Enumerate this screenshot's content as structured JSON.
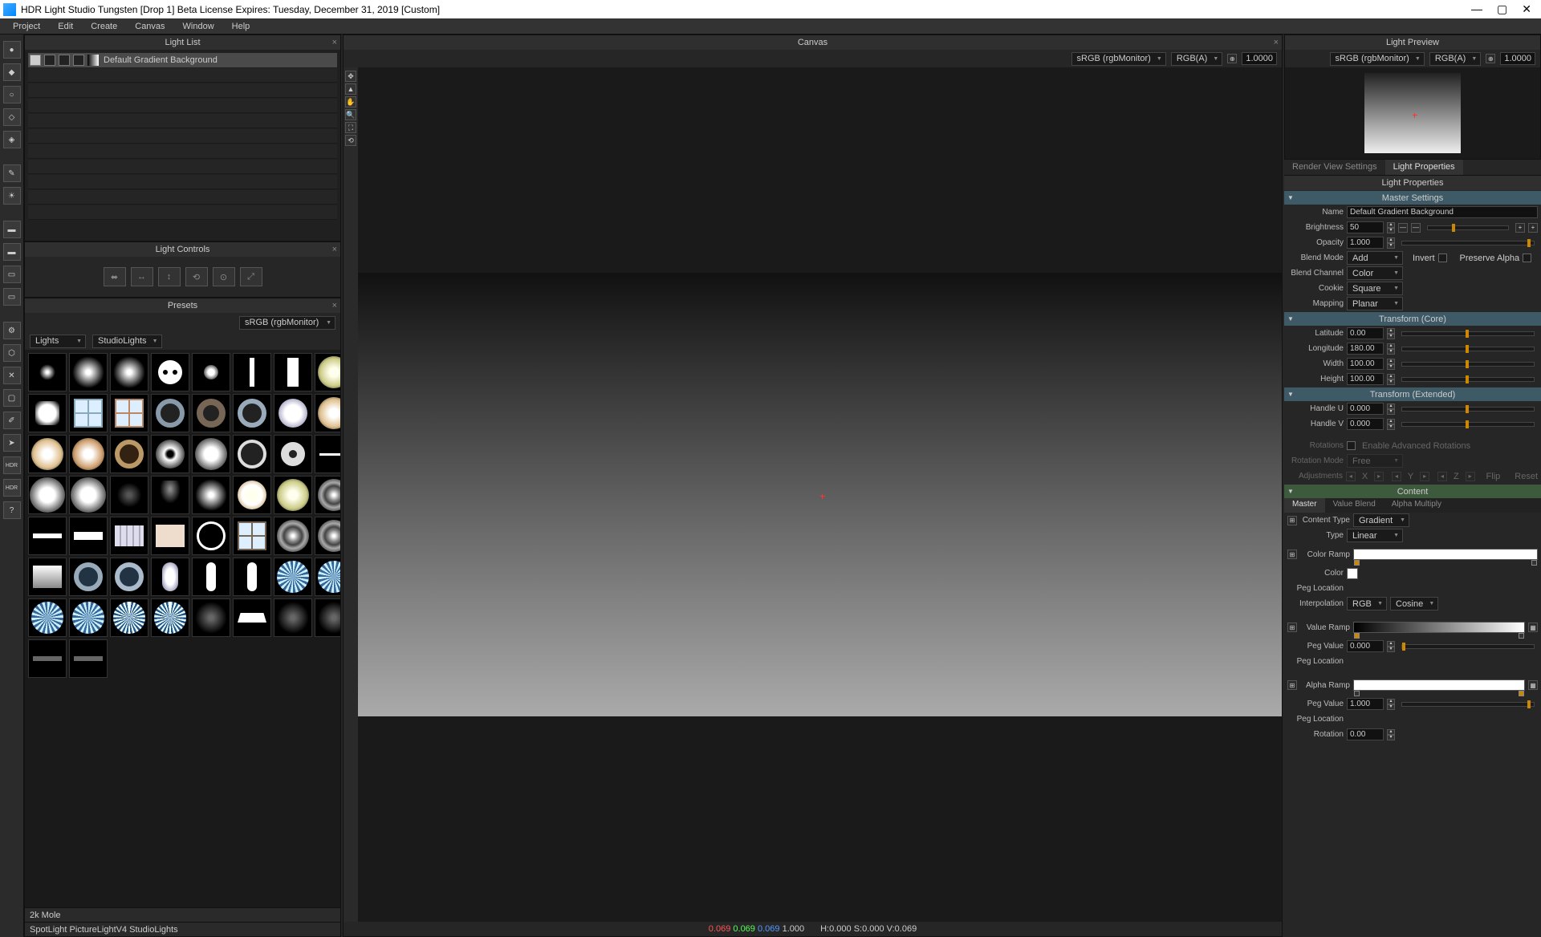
{
  "window": {
    "title": "HDR Light Studio Tungsten [Drop 1] Beta License Expires: Tuesday, December 31, 2019  [Custom]"
  },
  "menu": [
    "Project",
    "Edit",
    "Create",
    "Canvas",
    "Window",
    "Help"
  ],
  "panels": {
    "lightlist": "Light List",
    "lightctrl": "Light Controls",
    "presets": "Presets",
    "canvas": "Canvas",
    "preview": "Light Preview",
    "props": "Light Properties"
  },
  "lightlist": {
    "item": "Default Gradient Background"
  },
  "preset": {
    "colorspace": "sRGB (rgbMonitor)",
    "cat1": "Lights",
    "cat2": "StudioLights",
    "status1": "2k Mole",
    "status2": "SpotLight PictureLightV4 StudioLights"
  },
  "canvas": {
    "cs": "sRGB (rgbMonitor)",
    "mode": "RGB(A)",
    "exposure": "1.0000",
    "status_r": "0.069",
    "status_g": "0.069",
    "status_b": "0.069",
    "status_a": "1.000",
    "status_hsv": "H:0.000 S:0.000 V:0.069"
  },
  "preview": {
    "cs": "sRGB (rgbMonitor)",
    "mode": "RGB(A)",
    "exposure": "1.0000"
  },
  "tabs": {
    "rv": "Render View Settings",
    "lp": "Light Properties"
  },
  "sec": {
    "master": "Master Settings",
    "tcore": "Transform (Core)",
    "text": "Transform (Extended)",
    "content": "Content"
  },
  "prop": {
    "name_lbl": "Name",
    "name_val": "Default Gradient Background",
    "bright_lbl": "Brightness",
    "bright_val": "50",
    "opac_lbl": "Opacity",
    "opac_val": "1.000",
    "blend_lbl": "Blend Mode",
    "blend_val": "Add",
    "invert_lbl": "Invert",
    "preservea_lbl": "Preserve Alpha",
    "bchan_lbl": "Blend Channel",
    "bchan_val": "Color",
    "cookie_lbl": "Cookie",
    "cookie_val": "Square",
    "map_lbl": "Mapping",
    "map_val": "Planar",
    "lat_lbl": "Latitude",
    "lat_val": "0.00",
    "lon_lbl": "Longitude",
    "lon_val": "180.00",
    "w_lbl": "Width",
    "w_val": "100.00",
    "h_lbl": "Height",
    "h_val": "100.00",
    "hu_lbl": "Handle U",
    "hu_val": "0.000",
    "hv_lbl": "Handle V",
    "hv_val": "0.000",
    "rot_lbl": "Rotations",
    "rot_chk": "Enable Advanced Rotations",
    "rotm_lbl": "Rotation Mode",
    "rotm_val": "Free",
    "adj_lbl": "Adjustments",
    "adj_x": "X",
    "adj_y": "Y",
    "adj_z": "Z",
    "adj_flip": "Flip",
    "adj_reset": "Reset",
    "subtabs": [
      "Master",
      "Value Blend",
      "Alpha Multiply"
    ],
    "ctype_lbl": "Content Type",
    "ctype_val": "Gradient",
    "type_lbl": "Type",
    "type_val": "Linear",
    "cramp_lbl": "Color Ramp",
    "color_lbl": "Color",
    "pegloc_lbl": "Peg Location",
    "interp_lbl": "Interpolation",
    "interp_v1": "RGB",
    "interp_v2": "Cosine",
    "vramp_lbl": "Value Ramp",
    "pegv_lbl": "Peg Value",
    "pegv_val": "0.000",
    "aramp_lbl": "Alpha Ramp",
    "pegv2_val": "1.000",
    "rot2_lbl": "Rotation",
    "rot2_val": "0.00"
  }
}
